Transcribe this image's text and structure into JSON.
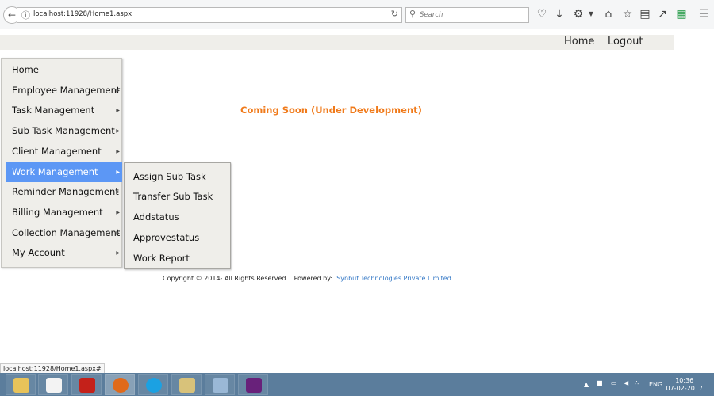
{
  "browser": {
    "url": "localhost:11928/Home1.aspx",
    "search_placeholder": "Search",
    "status_url": "localhost:11928/Home1.aspx#"
  },
  "header": {
    "home_label": "Home",
    "logout_label": "Logout"
  },
  "menu": {
    "items": [
      {
        "label": "Home",
        "has_submenu": false
      },
      {
        "label": "Employee Management",
        "has_submenu": true
      },
      {
        "label": "Task Management",
        "has_submenu": true
      },
      {
        "label": "Sub Task Management",
        "has_submenu": true
      },
      {
        "label": "Client Management",
        "has_submenu": true
      },
      {
        "label": "Work Management",
        "has_submenu": true,
        "active": true
      },
      {
        "label": "Reminder Management",
        "has_submenu": true
      },
      {
        "label": "Billing Management",
        "has_submenu": true
      },
      {
        "label": "Collection Management",
        "has_submenu": true
      },
      {
        "label": "My Account",
        "has_submenu": true
      }
    ]
  },
  "submenu": {
    "items": [
      "Assign Sub Task",
      "Transfer Sub Task",
      "Addstatus",
      "Approvestatus",
      "Work Report"
    ]
  },
  "main": {
    "message": "Coming Soon (Under Development)",
    "message_color": "#f07a1a"
  },
  "footer": {
    "copyright": "Copyright © 2014- All Rights Reserved.",
    "powered_by": "Powered by:",
    "company": "Synbuf Technologies Private Limited"
  },
  "taskbar": {
    "language": "ENG",
    "time": "10:36",
    "date": "07-02-2017",
    "apps": [
      "file-explorer-icon",
      "tally-icon",
      "pdf-reader-icon",
      "firefox-icon",
      "skype-icon",
      "tools-icon",
      "paint-icon",
      "visual-studio-icon"
    ]
  },
  "colors": {
    "accent": "#5c97f5",
    "link": "#3478c6",
    "menu_bg": "#efeeea",
    "taskbar": "#5b7d9c"
  }
}
